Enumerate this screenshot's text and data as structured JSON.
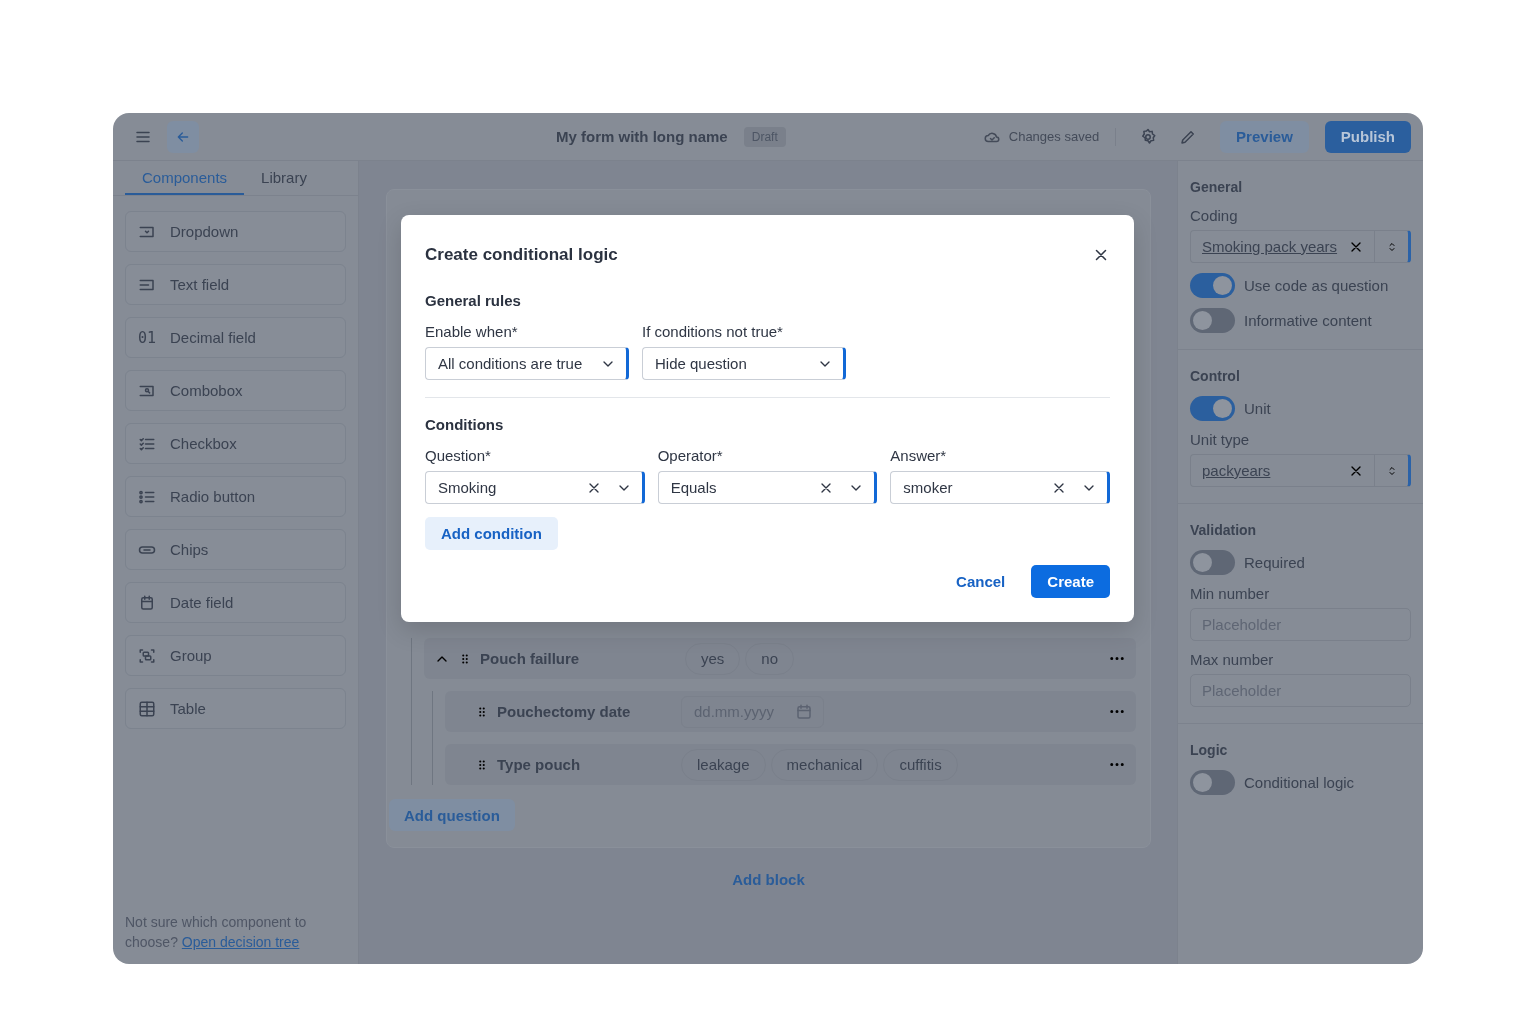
{
  "topbar": {
    "title": "My form with long name",
    "status_badge": "Draft",
    "save_status": "Changes saved",
    "preview": "Preview",
    "publish": "Publish"
  },
  "sidebar": {
    "tabs": [
      {
        "label": "Components",
        "selected": true
      },
      {
        "label": "Library",
        "selected": false
      }
    ],
    "components": [
      {
        "label": "Dropdown"
      },
      {
        "label": "Text field"
      },
      {
        "label": "Decimal field",
        "glyph": "01"
      },
      {
        "label": "Combobox"
      },
      {
        "label": "Checkbox"
      },
      {
        "label": "Radio button"
      },
      {
        "label": "Chips"
      },
      {
        "label": "Date field"
      },
      {
        "label": "Group"
      },
      {
        "label": "Table"
      }
    ],
    "hint": "Not sure which component to choose?",
    "hint_link": "Open decision tree"
  },
  "canvas": {
    "questions": [
      {
        "label": "Pouch faillure",
        "kind": "chips",
        "expanded": true,
        "options": [
          "yes",
          "no"
        ],
        "children": [
          {
            "label": "Pouchectomy date",
            "kind": "date",
            "placeholder": "dd.mm.yyyy"
          },
          {
            "label": "Type pouch",
            "kind": "chips",
            "options": [
              "leakage",
              "mechanical",
              "cuffitis"
            ]
          }
        ]
      }
    ],
    "add_question": "Add question",
    "add_block": "Add block"
  },
  "properties": [
    {
      "title": "General",
      "items": [
        {
          "kind": "combo",
          "label": "Coding",
          "value": "Smoking pack years"
        },
        {
          "kind": "toggle",
          "label": "Use code as question",
          "on": true
        },
        {
          "kind": "toggle",
          "label": "Informative content",
          "on": false
        }
      ]
    },
    {
      "title": "Control",
      "items": [
        {
          "kind": "toggle",
          "label": "Unit",
          "on": true
        },
        {
          "kind": "combo",
          "label": "Unit type",
          "value": "packyears"
        }
      ]
    },
    {
      "title": "Validation",
      "items": [
        {
          "kind": "toggle",
          "label": "Required",
          "on": false
        },
        {
          "kind": "input",
          "label": "Min number",
          "placeholder": "Placeholder"
        },
        {
          "kind": "input",
          "label": "Max number",
          "placeholder": "Placeholder"
        }
      ]
    },
    {
      "title": "Logic",
      "items": [
        {
          "kind": "toggle",
          "label": "Conditional logic",
          "on": false
        }
      ]
    }
  ],
  "modal": {
    "title": "Create conditional logic",
    "general_rules": "General rules",
    "rules": [
      {
        "label": "Enable when*",
        "value": "All conditions are true"
      },
      {
        "label": "If conditions not true*",
        "value": "Hide question"
      }
    ],
    "conditions_heading": "Conditions",
    "conditions": [
      {
        "label": "Question*",
        "value": "Smoking"
      },
      {
        "label": "Operator*",
        "value": "Equals"
      },
      {
        "label": "Answer*",
        "value": "smoker"
      }
    ],
    "add_condition": "Add condition",
    "cancel": "Cancel",
    "create": "Create"
  }
}
